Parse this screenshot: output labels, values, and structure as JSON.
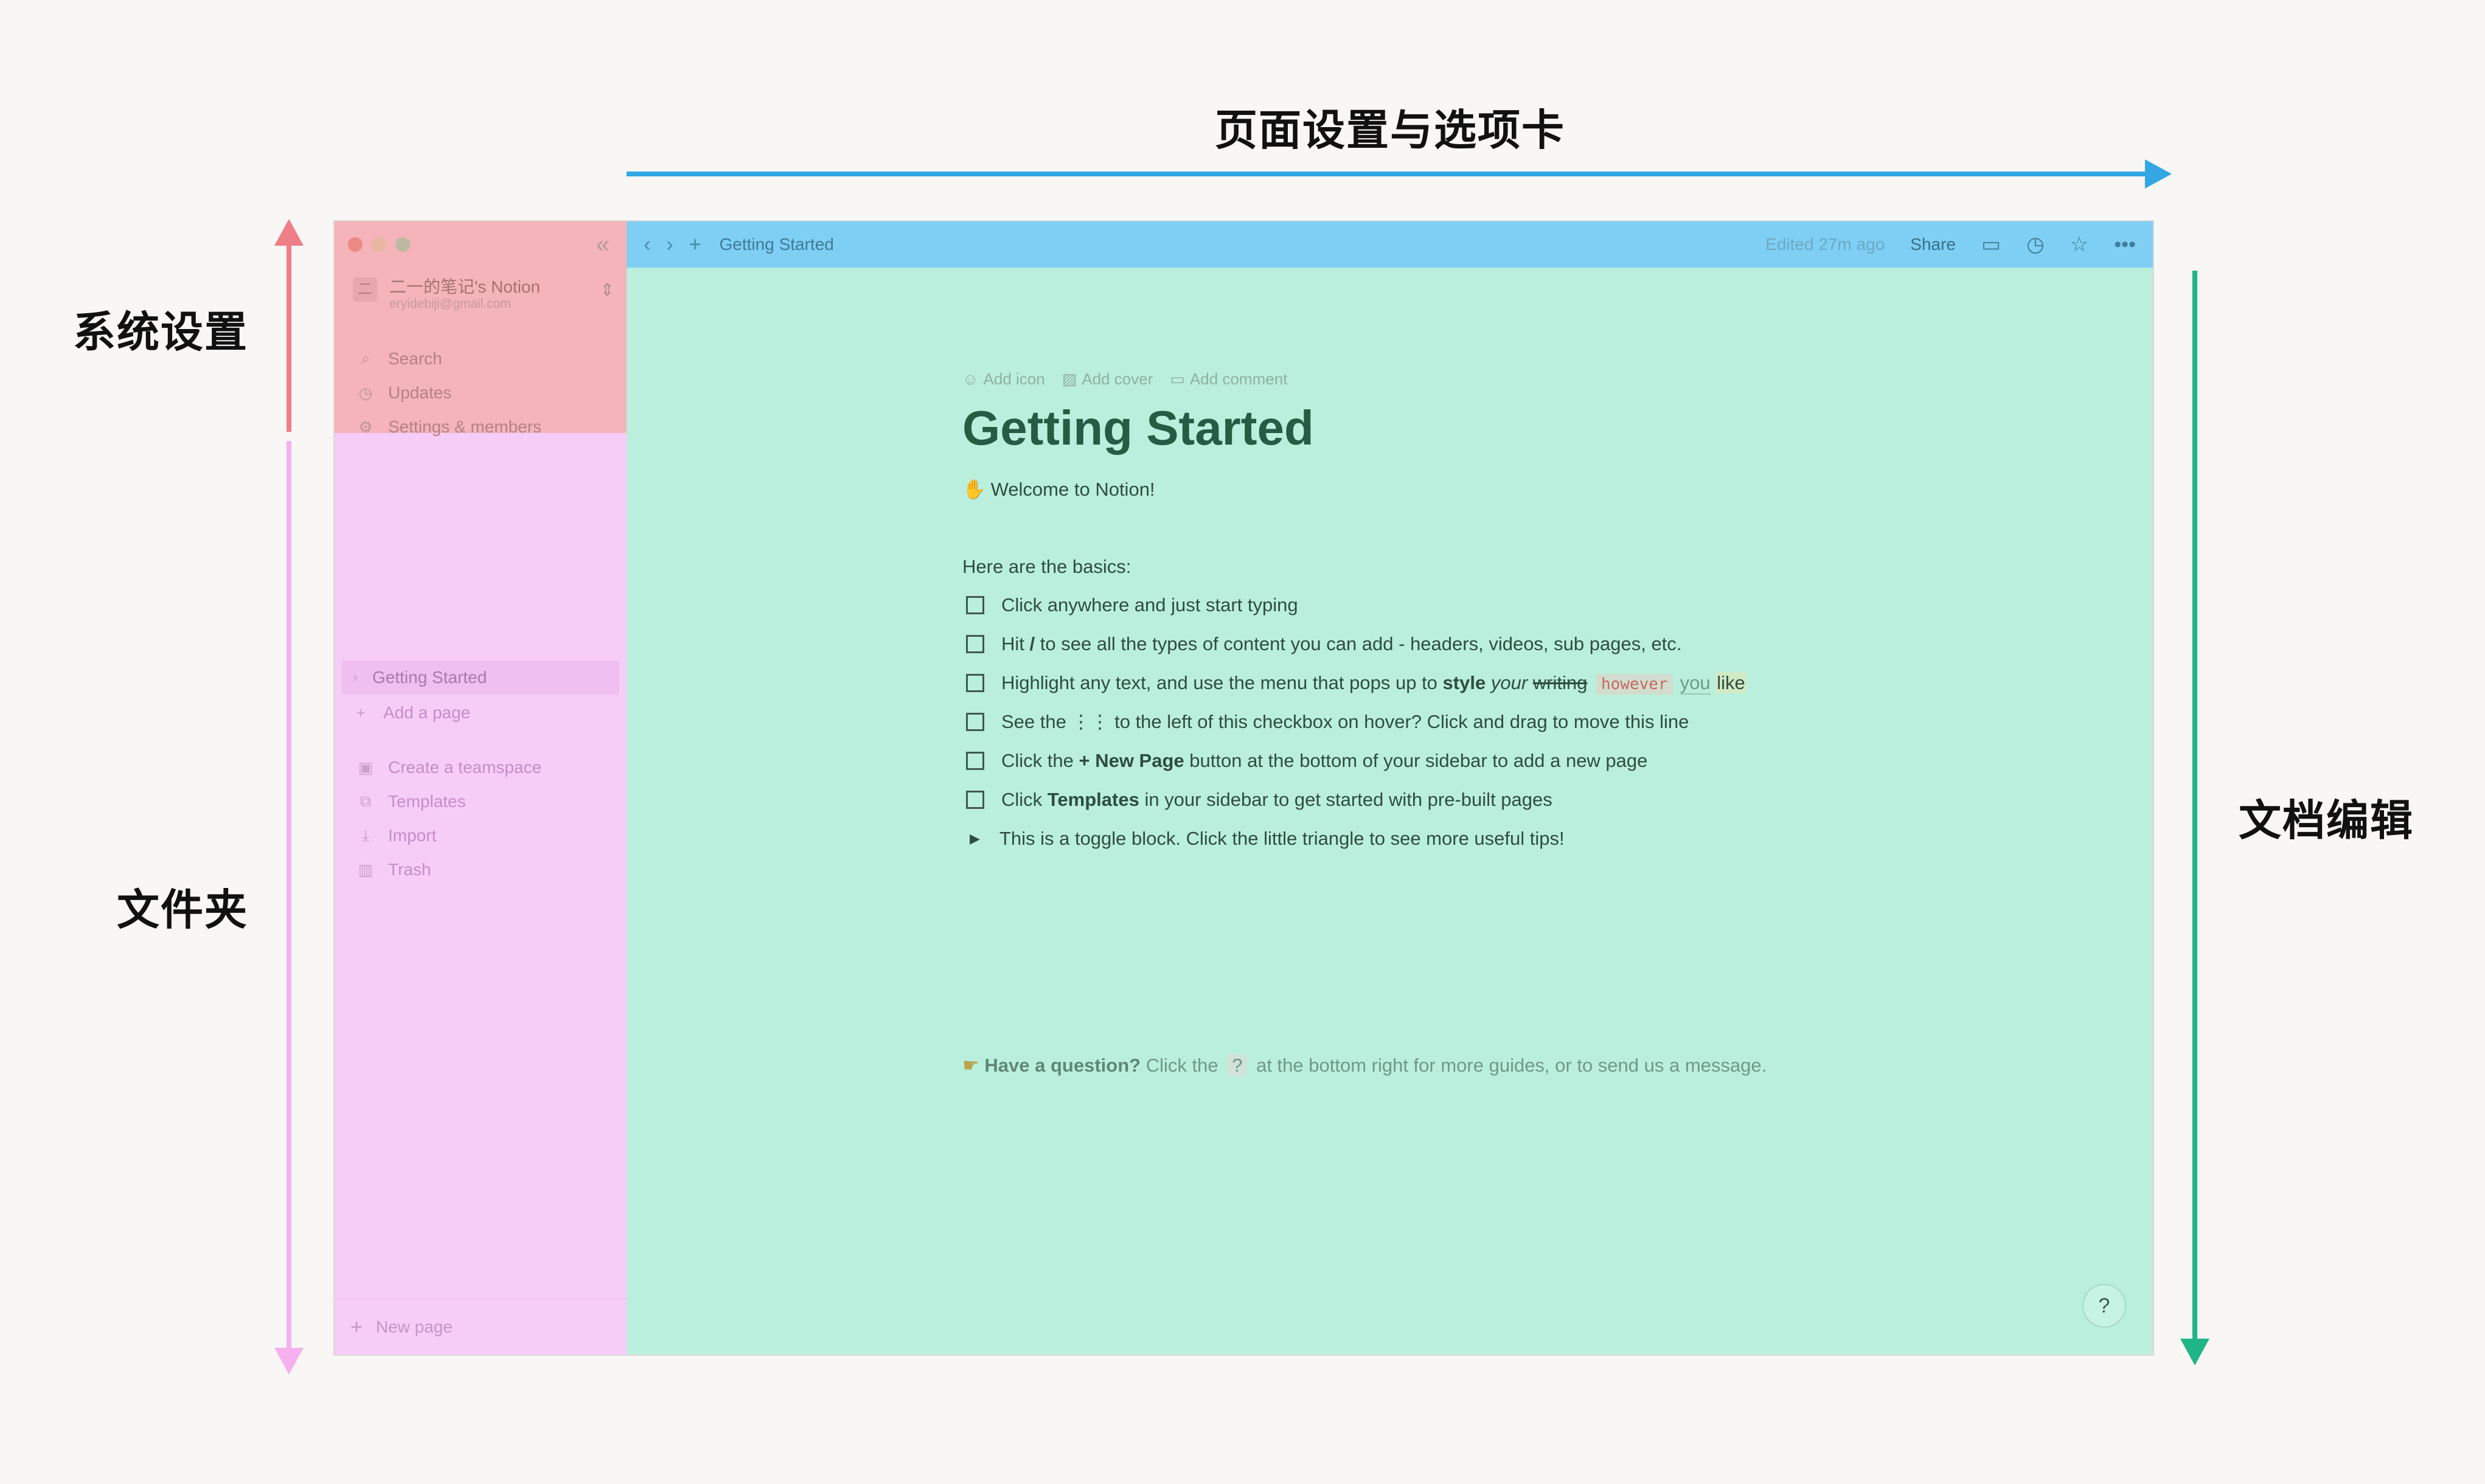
{
  "annotations": {
    "top": "页面设置与选项卡",
    "system": "系统设置",
    "folder": "文件夹",
    "doc": "文档编辑"
  },
  "sidebar": {
    "workspace_name": "二一的笔记's Notion",
    "workspace_email": "eryidebiji@gmail.com",
    "top_items": [
      {
        "label": "Search",
        "icon": "search-icon"
      },
      {
        "label": "Updates",
        "icon": "clock-icon"
      },
      {
        "label": "Settings & members",
        "icon": "gear-icon"
      }
    ],
    "page": "Getting Started",
    "add_page": "Add a page",
    "items": [
      {
        "label": "Create a teamspace",
        "icon": "teamspace-icon"
      },
      {
        "label": "Templates",
        "icon": "templates-icon"
      },
      {
        "label": "Import",
        "icon": "import-icon"
      },
      {
        "label": "Trash",
        "icon": "trash-icon"
      }
    ],
    "new_page": "New page"
  },
  "topbar": {
    "breadcrumb": "Getting Started",
    "edited": "Edited 27m ago",
    "share": "Share"
  },
  "doc": {
    "actions": {
      "add_icon": "Add icon",
      "add_cover": "Add cover",
      "add_comment": "Add comment"
    },
    "title": "Getting Started",
    "welcome": "Welcome to Notion!",
    "basics": "Here are the basics:",
    "todo1": "Click anywhere and just start typing",
    "todo2": {
      "a": "Hit ",
      "b": "/",
      "c": " to see all the types of content you can add - headers, videos, sub pages, etc."
    },
    "todo3": {
      "a": "Highlight any text, and use the menu that pops up to ",
      "b": "style",
      "c": "your",
      "d": "writing",
      "e": "however",
      "f": "you",
      "g": "like"
    },
    "todo4": {
      "a": "See the ",
      "b": "⋮⋮",
      "c": " to the left of this checkbox on hover? Click and drag to move this line"
    },
    "todo5": {
      "a": "Click the ",
      "b": "+ New Page",
      "c": " button at the bottom of your sidebar to add a new page"
    },
    "todo6": {
      "a": "Click ",
      "b": "Templates",
      "c": " in your sidebar to get started with pre-built pages"
    },
    "toggle": "This is a toggle block. Click the little triangle to see more useful tips!",
    "question": {
      "a": "Have a question?",
      "b": " Click the ",
      "c": "?",
      "d": " at the bottom right for more guides, or to send us a message."
    },
    "help": "?"
  },
  "colors": {
    "sidebar_top": "#f4b4b9",
    "sidebar": "#f6cdf7",
    "topbar": "#7fcff4",
    "main": "#bbefdd",
    "arrow_blue": "#33a7e4",
    "arrow_green": "#20b587"
  }
}
